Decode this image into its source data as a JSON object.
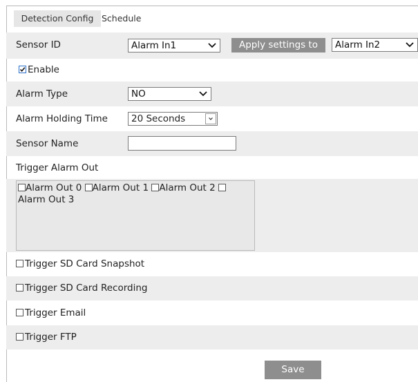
{
  "tabs": [
    {
      "label": "Detection Config",
      "active": true
    },
    {
      "label": "Schedule",
      "active": false
    }
  ],
  "sensor_id": {
    "label": "Sensor ID",
    "value": "Alarm In1"
  },
  "apply_settings": {
    "label": "Apply settings to",
    "value": "Alarm In2"
  },
  "enable": {
    "label": "Enable",
    "checked": true
  },
  "alarm_type": {
    "label": "Alarm Type",
    "value": "NO"
  },
  "alarm_holding_time": {
    "label": "Alarm Holding Time",
    "value": "20 Seconds"
  },
  "sensor_name": {
    "label": "Sensor Name",
    "value": ""
  },
  "trigger_alarm_out": {
    "label": "Trigger Alarm Out",
    "items": [
      {
        "label": "Alarm Out 0",
        "checked": false
      },
      {
        "label": "Alarm Out 1",
        "checked": false
      },
      {
        "label": "Alarm Out 2",
        "checked": false
      },
      {
        "label": "Alarm Out 3",
        "checked": false
      }
    ]
  },
  "triggers": [
    {
      "label": "Trigger SD Card Snapshot",
      "checked": false
    },
    {
      "label": "Trigger SD Card Recording",
      "checked": false
    },
    {
      "label": "Trigger Email",
      "checked": false
    },
    {
      "label": "Trigger FTP",
      "checked": false
    }
  ],
  "save_label": "Save",
  "colors": {
    "row_shade": "#ededed",
    "button_bg": "#8e8e8e",
    "button_text": "#ffffff"
  },
  "icons": {
    "dropdown": "chevron-down-icon",
    "checkbox": "checkbox-icon"
  }
}
